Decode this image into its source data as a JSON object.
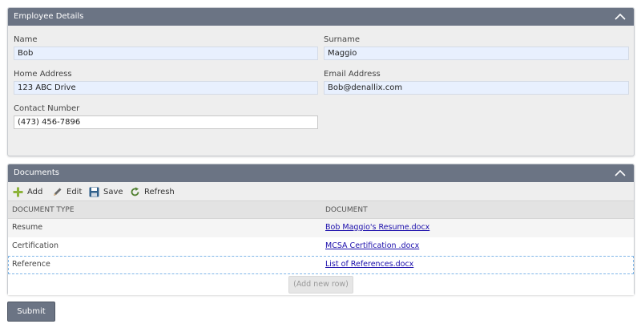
{
  "employee_panel": {
    "title": "Employee Details",
    "fields": {
      "name": {
        "label": "Name",
        "value": "Bob"
      },
      "surname": {
        "label": "Surname",
        "value": "Maggio"
      },
      "home_address": {
        "label": "Home Address",
        "value": "123 ABC Drive"
      },
      "email_address": {
        "label": "Email Address",
        "value": "Bob@denallix.com"
      },
      "contact_number": {
        "label": "Contact Number",
        "value": "(473) 456-7896"
      }
    }
  },
  "documents_panel": {
    "title": "Documents",
    "toolbar": {
      "add": "Add",
      "edit": "Edit",
      "save": "Save",
      "refresh": "Refresh"
    },
    "columns": [
      "DOCUMENT TYPE",
      "DOCUMENT"
    ],
    "rows": [
      {
        "type": "Resume",
        "document": "Bob Maggio's Resume.docx"
      },
      {
        "type": "Certification",
        "document": "MCSA Certification .docx"
      },
      {
        "type": "Reference",
        "document": "List of References.docx"
      }
    ],
    "add_row_label": "(Add new row)"
  },
  "submit_label": "Submit",
  "colors": {
    "header": "#6b7484",
    "input_bg": "#e8f0fe",
    "link": "#1a0dab",
    "add_icon": "#8db33a",
    "save_icon": "#2f5f8a"
  }
}
